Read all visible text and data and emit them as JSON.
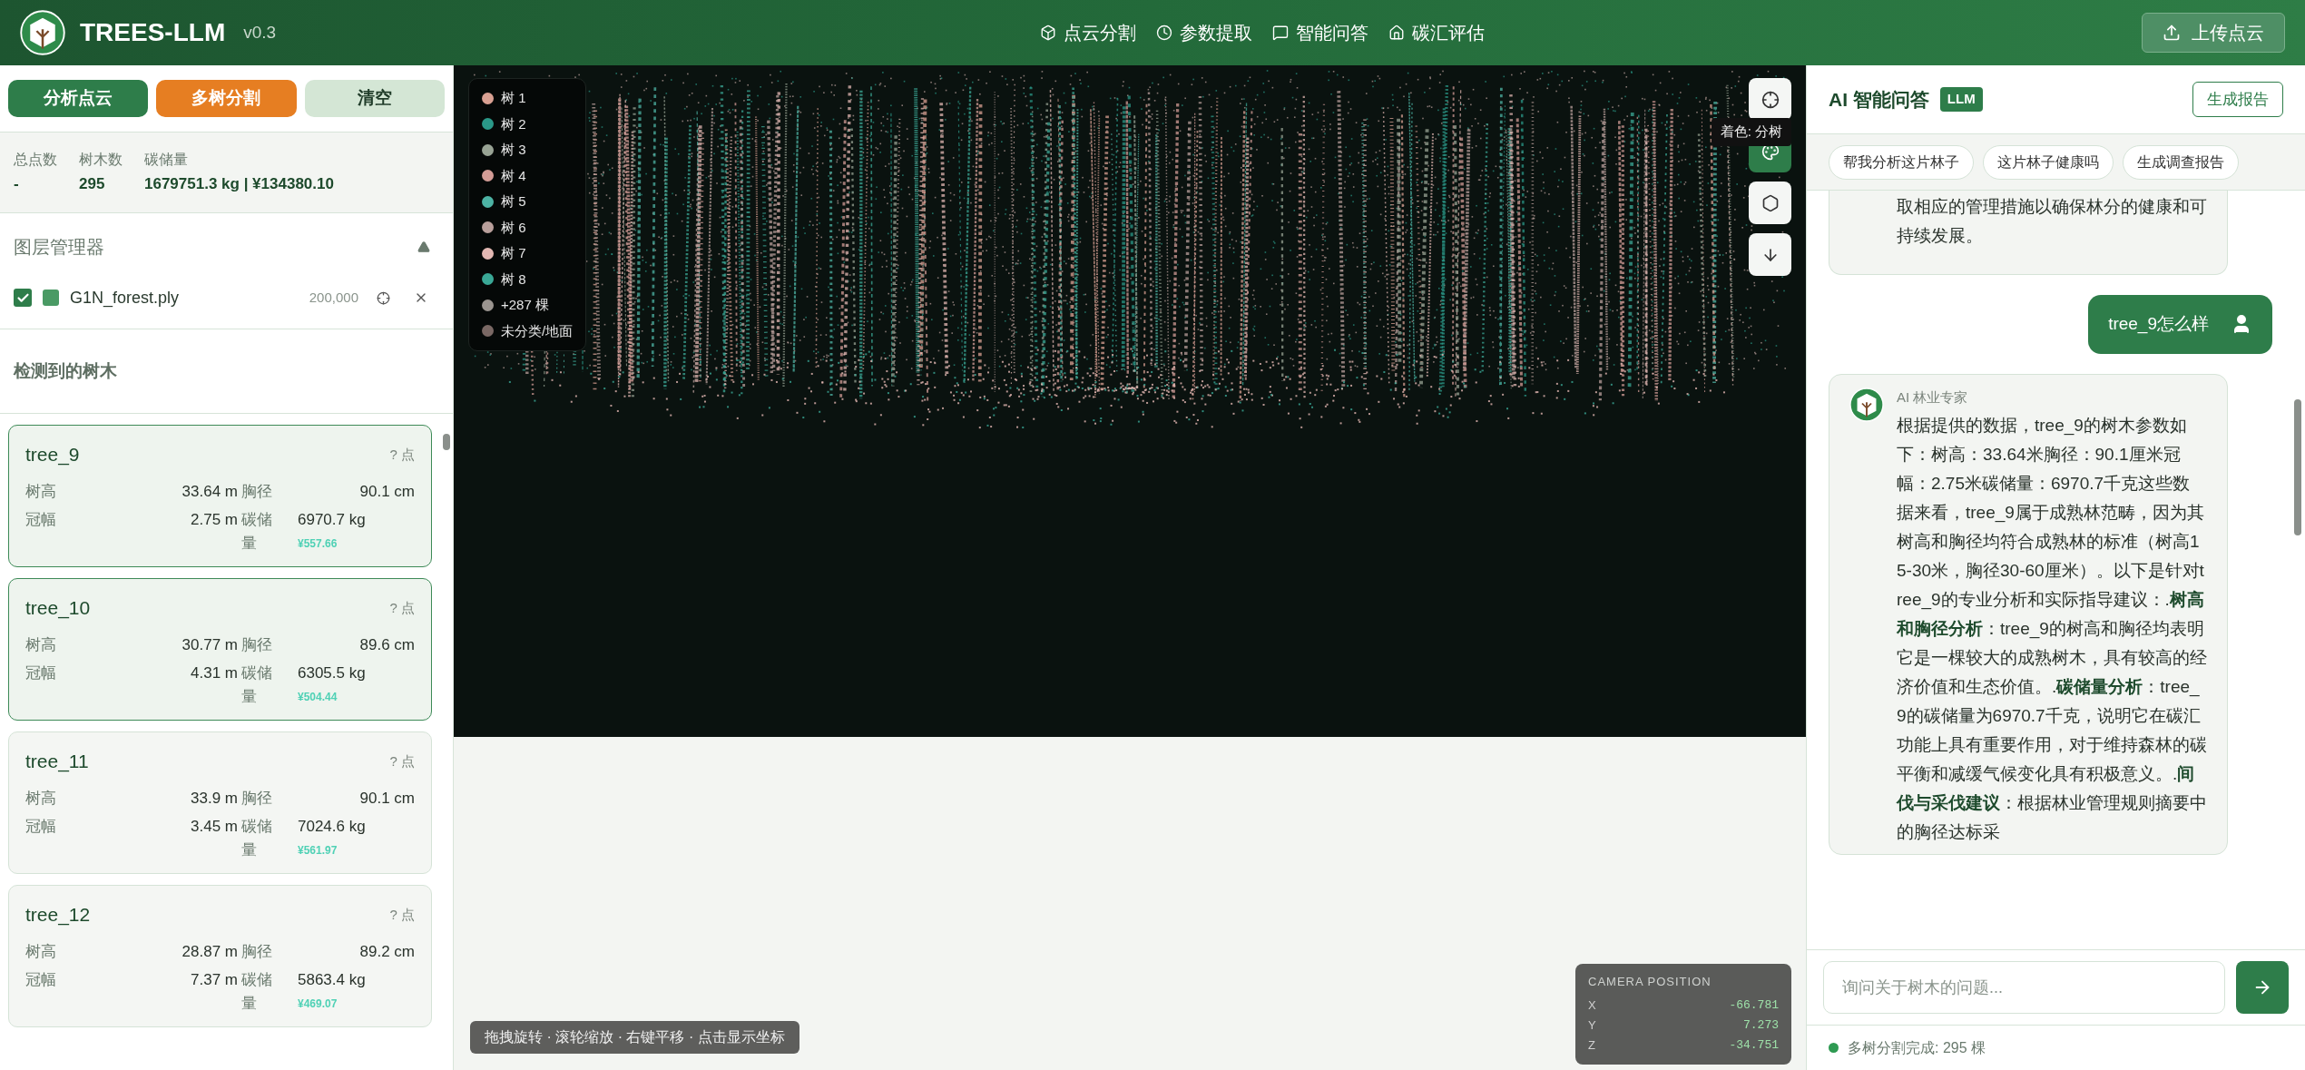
{
  "header": {
    "app_name": "TREES-LLM",
    "version": "v0.3",
    "nav": [
      {
        "label": "点云分割"
      },
      {
        "label": "参数提取"
      },
      {
        "label": "智能问答"
      },
      {
        "label": "碳汇评估"
      }
    ],
    "upload_button": "上传点云"
  },
  "left_panel": {
    "actions": [
      {
        "label": "分析点云",
        "kind": "primary"
      },
      {
        "label": "多树分割",
        "kind": "accent"
      },
      {
        "label": "清空",
        "kind": "muted"
      }
    ],
    "stats": [
      {
        "label": "总点数",
        "value": "-"
      },
      {
        "label": "树木数",
        "value": "295"
      },
      {
        "label": "碳储量",
        "value": "1679751.3 kg | ¥134380.10"
      }
    ],
    "layer_manager": {
      "title": "图层管理器",
      "expanded": true,
      "layers": [
        {
          "name": "G1N_forest.ply",
          "count": "200,000",
          "checked": true,
          "color": "#4a9a64"
        }
      ]
    },
    "trees_title": "检测到的树木",
    "trees": [
      {
        "name": "tree_9",
        "points": "? 点",
        "selected": true,
        "height_label": "树高",
        "height": "33.64 m",
        "dbh_label": "胸径",
        "dbh": "90.1 cm",
        "crown_label": "冠幅",
        "crown": "2.75 m",
        "carbon_label": "碳储量",
        "carbon": "6970.7 kg",
        "price": "¥557.66"
      },
      {
        "name": "tree_10",
        "points": "? 点",
        "selected": true,
        "height_label": "树高",
        "height": "30.77 m",
        "dbh_label": "胸径",
        "dbh": "89.6 cm",
        "crown_label": "冠幅",
        "crown": "4.31 m",
        "carbon_label": "碳储量",
        "carbon": "6305.5 kg",
        "price": "¥504.44"
      },
      {
        "name": "tree_11",
        "points": "? 点",
        "selected": false,
        "height_label": "树高",
        "height": "33.9 m",
        "dbh_label": "胸径",
        "dbh": "90.1 cm",
        "crown_label": "冠幅",
        "crown": "3.45 m",
        "carbon_label": "碳储量",
        "carbon": "7024.6 kg",
        "price": "¥561.97"
      },
      {
        "name": "tree_12",
        "points": "? 点",
        "selected": false,
        "height_label": "树高",
        "height": "28.87 m",
        "dbh_label": "胸径",
        "dbh": "89.2 cm",
        "crown_label": "冠幅",
        "crown": "7.37 m",
        "carbon_label": "碳储量",
        "carbon": "5863.4 kg",
        "price": "¥469.07"
      }
    ]
  },
  "viewer": {
    "legend": [
      {
        "label": "树 1",
        "color": "#d9a092"
      },
      {
        "label": "树 2",
        "color": "#2a9888"
      },
      {
        "label": "树 3",
        "color": "#98a394"
      },
      {
        "label": "树 4",
        "color": "#d39c96"
      },
      {
        "label": "树 5",
        "color": "#4db3a4"
      },
      {
        "label": "树 6",
        "color": "#b99f9b"
      },
      {
        "label": "树 7",
        "color": "#e3b8b3"
      },
      {
        "label": "树 8",
        "color": "#3aa896"
      },
      {
        "label": "+287 棵",
        "color": "#9a948f"
      },
      {
        "label": "未分类/地面",
        "color": "#7a6864"
      }
    ],
    "tools": [
      {
        "active": false
      },
      {
        "active": true
      },
      {
        "active": false
      },
      {
        "active": false
      }
    ],
    "tooltip": "着色: 分树",
    "camera": {
      "title": "CAMERA POSITION",
      "coords": [
        {
          "axis": "X",
          "value": "-66.781"
        },
        {
          "axis": "Y",
          "value": "7.273"
        },
        {
          "axis": "Z",
          "value": "-34.751"
        }
      ]
    },
    "hint": "拖拽旋转 · 滚轮缩放 · 右键平移 · 点击显示坐标"
  },
  "chat": {
    "title": "AI 智能问答",
    "badge": "LLM",
    "report_button": "生成报告",
    "suggestions": [
      "帮我分析这片林子",
      "这片林子健康吗",
      "生成调查报告"
    ],
    "messages": [
      {
        "kind": "ai",
        "text": "取相应的管理措施以确保林分的健康和可持续发展。"
      },
      {
        "kind": "user",
        "text": "tree_9怎么样"
      },
      {
        "kind": "ai",
        "sender": "AI 林业专家",
        "text": "根据提供的数据，tree_9的树木参数如下：树高：33.64米胸径：90.1厘米冠幅：2.75米碳储量：6970.7千克这些数据来看，tree_9属于成熟林范畴，因为其树高和胸径均符合成熟林的标准（树高15-30米，胸径30-60厘米）。以下是针对tree_9的专业分析和实际指导建议：.**树高和胸径分析**：tree_9的树高和胸径均表明它是一棵较大的成熟树木，具有较高的经济价值和生态价值。.**碳储量分析**：tree_9的碳储量为6970.7千克，说明它在碳汇功能上具有重要作用，对于维持森林的碳平衡和减缓气候变化具有积极意义。.**间伐与采伐建议**：根据林业管理规则摘要中的胸径达标采"
      }
    ],
    "input_placeholder": "询问关于树木的问题...",
    "status": {
      "text": "多树分割完成: 295 棵",
      "color": "#2e9a52"
    }
  }
}
